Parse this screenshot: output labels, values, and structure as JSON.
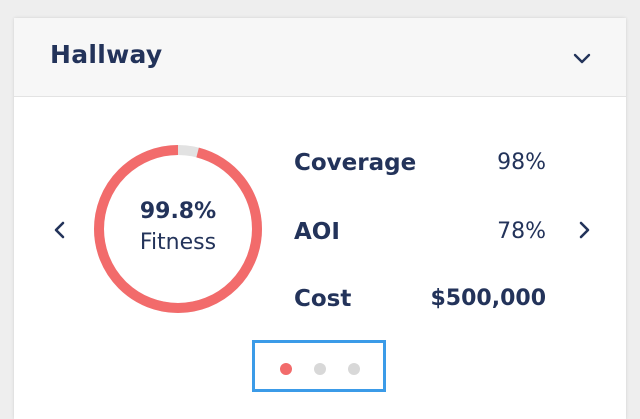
{
  "card": {
    "title": "Hallway",
    "collapse_icon": "chevron-down-icon"
  },
  "gauge": {
    "value_text": "99.8%",
    "label": "Fitness",
    "fraction": 0.998,
    "color": "#f26b6b",
    "track_color": "#e2e2e2"
  },
  "stats": [
    {
      "label": "Coverage",
      "value": "98%"
    },
    {
      "label": "AOI",
      "value": "78%"
    },
    {
      "label": "Cost",
      "value": "$500,000"
    }
  ],
  "navigation": {
    "prev_icon": "chevron-left-icon",
    "next_icon": "chevron-right-icon"
  },
  "pagination": {
    "total": 3,
    "active_index": 0,
    "active_color": "#f26b6b",
    "inactive_color": "#d8d8d8",
    "highlight_color": "#3b9be8"
  },
  "colors": {
    "text": "#23335a",
    "header_bg": "#f7f7f7"
  }
}
